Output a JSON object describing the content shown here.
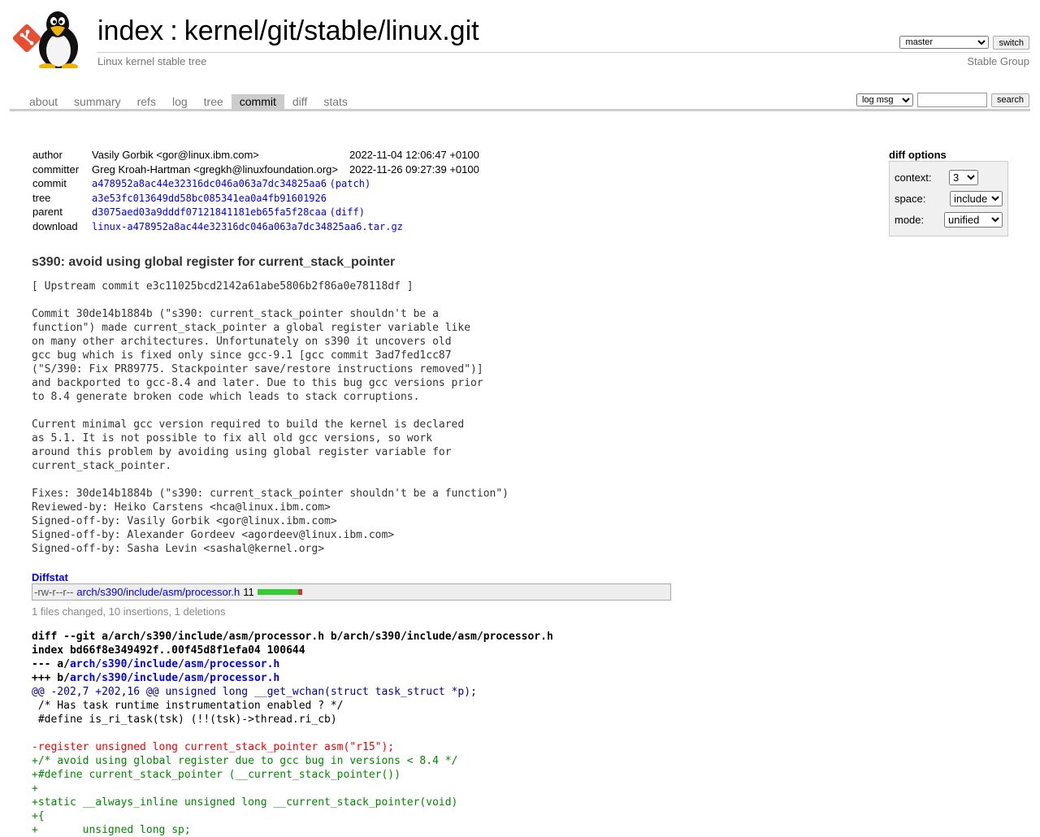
{
  "header": {
    "title_index": "index",
    "title_separator": ":",
    "title_repo": "kernel/git/stable/linux.git",
    "description": "Linux kernel stable tree",
    "owner": "Stable Group",
    "branch_selected": "master",
    "switch_label": "switch"
  },
  "tabs": [
    {
      "label": "about"
    },
    {
      "label": "summary"
    },
    {
      "label": "refs"
    },
    {
      "label": "log"
    },
    {
      "label": "tree"
    },
    {
      "label": "commit",
      "active": true
    },
    {
      "label": "diff"
    },
    {
      "label": "stats"
    }
  ],
  "search": {
    "scope_selected": "log msg",
    "query": "",
    "button_label": "search"
  },
  "commit_info": {
    "author_label": "author",
    "author": "Vasily Gorbik <gor@linux.ibm.com>",
    "author_date": "2022-11-04 12:06:47 +0100",
    "committer_label": "committer",
    "committer": "Greg Kroah-Hartman <gregkh@linuxfoundation.org>",
    "committer_date": "2022-11-26 09:27:39 +0100",
    "commit_label": "commit",
    "commit_hash": "a478952a8ac44e32316dc046a063a7dc34825aa6",
    "commit_link": "(patch)",
    "tree_label": "tree",
    "tree_hash": "a3e53fc013649dd58bc085341ea0a4fb91601926",
    "parent_label": "parent",
    "parent_hash": "d3075aed03a9dddf07121841181eb65fa5f28caa",
    "parent_link": "(diff)",
    "download_label": "download",
    "download_file": "linux-a478952a8ac44e32316dc046a063a7dc34825aa6.tar.gz"
  },
  "diff_options": {
    "title": "diff options",
    "context_label": "context:",
    "context_value": "3",
    "space_label": "space:",
    "space_value": "include",
    "mode_label": "mode:",
    "mode_value": "unified"
  },
  "subject": "s390: avoid using global register for current_stack_pointer",
  "message": "[ Upstream commit e3c11025bcd2142a61abe5806b2f86a0e78118df ]\n\nCommit 30de14b1884b (\"s390: current_stack_pointer shouldn't be a\nfunction\") made current_stack_pointer a global register variable like\non many other architectures. Unfortunately on s390 it uncovers old\ngcc bug which is fixed only since gcc-9.1 [gcc commit 3ad7fed1cc87\n(\"S/390: Fix PR89775. Stackpointer save/restore instructions removed\")]\nand backported to gcc-8.4 and later. Due to this bug gcc versions prior\nto 8.4 generate broken code which leads to stack corruptions.\n\nCurrent minimal gcc version required to build the kernel is declared\nas 5.1. It is not possible to fix all old gcc versions, so work\naround this problem by avoiding using global register variable for\ncurrent_stack_pointer.\n\nFixes: 30de14b1884b (\"s390: current_stack_pointer shouldn't be a function\")\nReviewed-by: Heiko Carstens <hca@linux.ibm.com>\nSigned-off-by: Vasily Gorbik <gor@linux.ibm.com>\nSigned-off-by: Alexander Gordeev <agordeev@linux.ibm.com>\nSigned-off-by: Sasha Levin <sashal@kernel.org>",
  "diffstat": {
    "title": "Diffstat",
    "mode": "-rw-r--r--",
    "file": "arch/s390/include/asm/processor.h",
    "changes": "11",
    "insertions": 10,
    "deletions": 1,
    "summary": "1 files changed, 10 insertions, 1 deletions",
    "colors": {
      "insert": "#33cc33",
      "delete": "#cc3333"
    }
  },
  "diff": {
    "git_line": "diff --git a/arch/s390/include/asm/processor.h b/arch/s390/include/asm/processor.h",
    "index_line": "index bd66f8e349492f..00f45d8f1efa04 100644",
    "minus_prefix": "--- a/",
    "plus_prefix": "+++ b/",
    "file": "arch/s390/include/asm/processor.h",
    "lines": [
      {
        "type": "hunk",
        "text": "@@ -202,7 +202,16 @@ unsigned long __get_wchan(struct task_struct *p);"
      },
      {
        "type": "ctx",
        "text": " /* Has task runtime instrumentation enabled ? */"
      },
      {
        "type": "ctx",
        "text": " #define is_ri_task(tsk) (!!(tsk)->thread.ri_cb)"
      },
      {
        "type": "ctx",
        "text": " "
      },
      {
        "type": "rem",
        "text": "-register unsigned long current_stack_pointer asm(\"r15\");"
      },
      {
        "type": "add",
        "text": "+/* avoid using global register due to gcc bug in versions < 8.4 */"
      },
      {
        "type": "add",
        "text": "+#define current_stack_pointer (__current_stack_pointer())"
      },
      {
        "type": "add",
        "text": "+"
      },
      {
        "type": "add",
        "text": "+static __always_inline unsigned long __current_stack_pointer(void)"
      },
      {
        "type": "add",
        "text": "+{"
      },
      {
        "type": "add",
        "text": "+\tunsigned long sp;"
      }
    ]
  }
}
